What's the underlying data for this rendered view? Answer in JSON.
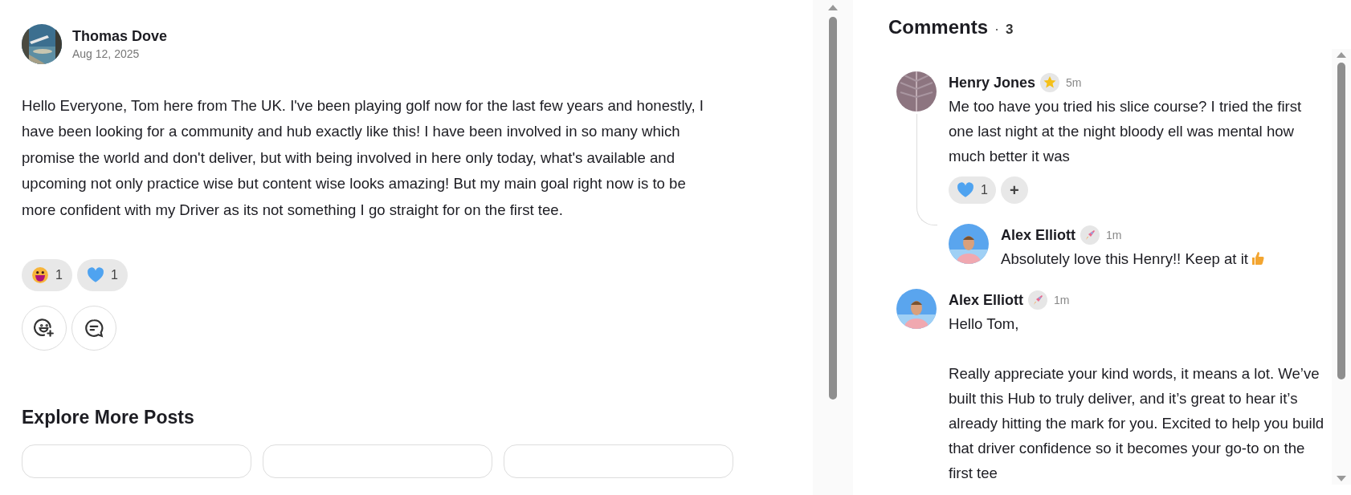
{
  "post": {
    "author": "Thomas Dove",
    "date": "Aug 12, 2025",
    "avatar": {
      "kind": "picture"
    },
    "body": "Hello Everyone, Tom here from The UK. I've been playing golf now for the last few years and honestly, I have been looking for a community and hub exactly like this! I have been involved in so many which promise the world and don't deliver, but with being involved in here only today, what's available and upcoming not only practice wise but content wise looks amazing! But my main goal right now is to be more confident with my Driver as its not something I go straight for on the first tee.",
    "reactions": [
      {
        "kind": "grin",
        "count": "1"
      },
      {
        "kind": "heart",
        "count": "1"
      }
    ],
    "actions": [
      {
        "kind": "add-reaction"
      },
      {
        "kind": "comment"
      }
    ]
  },
  "explore": {
    "title": "Explore More Posts"
  },
  "comments": {
    "title": "Comments",
    "separator": "·",
    "count": "3",
    "items": [
      {
        "author": "Henry Jones",
        "badge": {
          "kind": "star"
        },
        "time": "5m",
        "avatar": {
          "kind": "picture"
        },
        "paragraphs": [
          "Me too have you tried his slice course? I tried the first one last night at the night bloody ell was mental how much better it was"
        ],
        "reactions": [
          {
            "kind": "heart",
            "count": "1"
          }
        ],
        "add_reaction": "+",
        "replies": [
          {
            "author": "Alex Elliott",
            "badge": {
              "kind": "rocket"
            },
            "time": "1m",
            "avatar": {
              "kind": "picture"
            },
            "paragraphs": [
              "Absolutely love this Henry!! Keep at it"
            ],
            "end_icon": {
              "kind": "thumbs-up"
            }
          }
        ]
      },
      {
        "author": "Alex Elliott",
        "badge": {
          "kind": "rocket"
        },
        "time": "1m",
        "avatar": {
          "kind": "picture"
        },
        "paragraphs": [
          "Hello Tom,",
          "Really appreciate your kind words, it means a lot. We’ve built this Hub to truly deliver, and it’s great to hear it’s already hitting the mark for you. Excited to help you build that driver confidence so it becomes your go-to on the first tee"
        ]
      }
    ]
  }
}
